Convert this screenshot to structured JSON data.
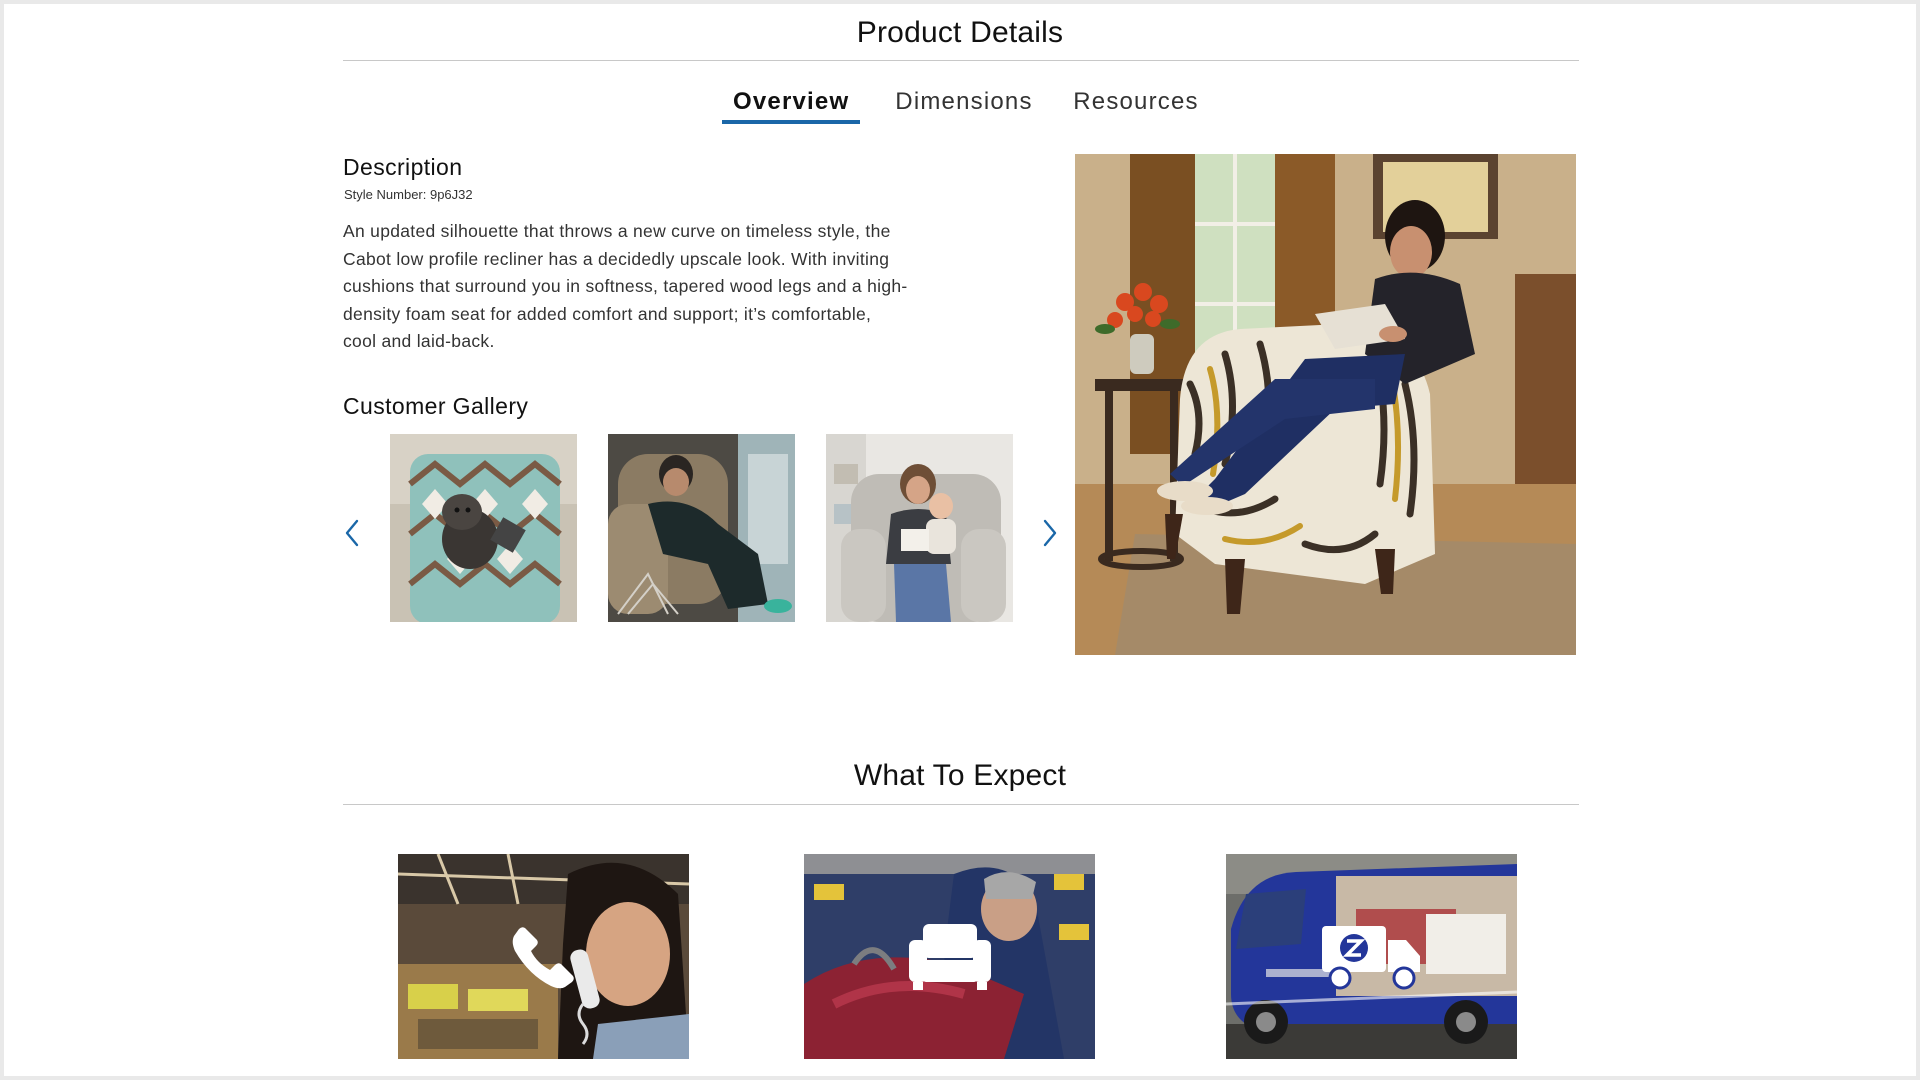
{
  "product_details": {
    "title": "Product Details",
    "tabs": [
      {
        "label": "Overview",
        "active": true
      },
      {
        "label": "Dimensions",
        "active": false
      },
      {
        "label": "Resources",
        "active": false
      }
    ],
    "accent_color": "#1a67a8"
  },
  "overview": {
    "description_heading": "Description",
    "style_number": "Style Number: 9p6J32",
    "description_lines": [
      "An updated silhouette that throws a new curve on timeless style, the",
      "Cabot low profile recliner has a decidedly upscale look. With inviting",
      "cushions that surround you in softness, tapered wood legs and a high-",
      "density foam seat for added comfort and support; it’s comfortable,",
      "cool and laid-back."
    ],
    "gallery_heading": "Customer Gallery",
    "gallery_prev_icon": "chevron-left-icon",
    "gallery_next_icon": "chevron-right-icon",
    "gallery_images": [
      "dog-on-patterned-recliner",
      "woman-in-tan-recliner",
      "mother-and-baby-in-gray-recliner"
    ],
    "hero_image": "woman-reading-in-striped-recliner"
  },
  "what_to_expect": {
    "title": "What To Expect",
    "cards": [
      {
        "image": "woman-on-phone-in-showroom",
        "icon": "phone-icon"
      },
      {
        "image": "craftsman-building-recliner",
        "icon": "armchair-icon"
      },
      {
        "image": "delivery-van",
        "icon": "delivery-truck-icon"
      }
    ]
  }
}
